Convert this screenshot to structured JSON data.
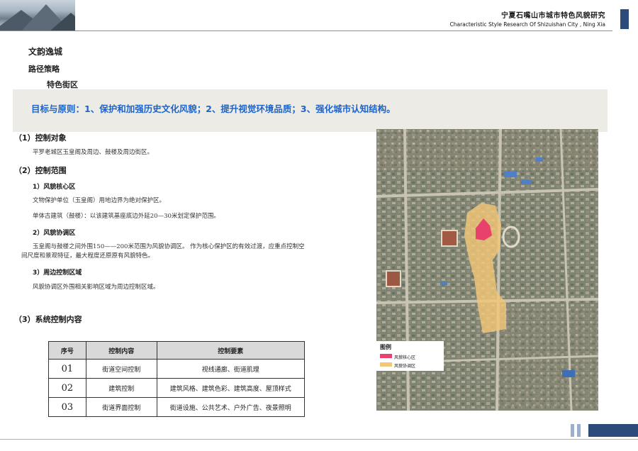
{
  "header": {
    "title": "宁夏石嘴山市城市特色风貌研究",
    "subtitle": "Characteristic  Style Research Of Shizuishan City , Ning Xia"
  },
  "page_title": "文韵逸城",
  "section_title": "路径策略",
  "sub_title": "特色街区",
  "banner": "目标与原则：1、保护和加强历史文化风貌；2、提升视觉环境品质；3、强化城市认知结构。",
  "sections": [
    {
      "heading": "（1）控制对象",
      "text": "平罗老城区玉皇阁及周边、鼓楼及周边街区。"
    },
    {
      "heading": "（2）控制范围",
      "items": [
        {
          "label": "1）风貌核心区",
          "lines": [
            "文物保护单位（玉皇阁）用地边界为绝对保护区。",
            "单体古建筑（鼓楼）：以该建筑基座底边外延20—30米划定保护范围。"
          ]
        },
        {
          "label": "2）风貌协调区",
          "lines": [
            "玉皇阁与鼓楼之间外围150——200米范围为风貌协调区。 作为核心保护区的有效过渡，应重点控制空",
            "间尺度和景观特征，最大程度还原原有风貌特色。"
          ]
        },
        {
          "label": "3）周边控制区域",
          "lines": [
            "风貌协调区外围相关影响区域为周边控制区域。"
          ]
        }
      ]
    },
    {
      "heading": "（3）系统控制内容"
    }
  ],
  "table": {
    "headers": [
      "序号",
      "控制内容",
      "控制要素"
    ],
    "rows": [
      [
        "01",
        "街道空间控制",
        "视线通廊、街道肌理"
      ],
      [
        "02",
        "建筑控制",
        "建筑风格、建筑色彩、建筑高度、屋顶样式"
      ],
      [
        "03",
        "街道界面控制",
        "街道设施、公共艺术、户外广告、夜景照明"
      ]
    ]
  },
  "legend": {
    "title": "图例",
    "items": [
      {
        "label": "风貌核心区",
        "color": "#e8416b"
      },
      {
        "label": "风貌协调区",
        "color": "#f2c777"
      }
    ]
  },
  "colors": {
    "accent": "#1e63c8",
    "brand": "#2c4a7a"
  }
}
